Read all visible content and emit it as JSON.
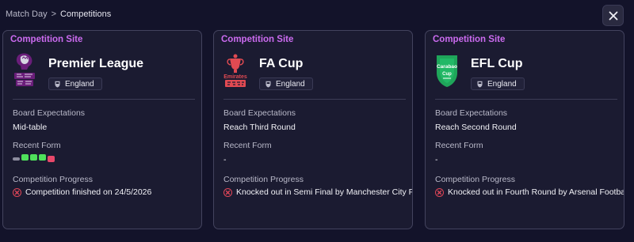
{
  "breadcrumb": {
    "parent": "Match Day",
    "separator": ">",
    "current": "Competitions"
  },
  "colors": {
    "accent": "#cc6bf0",
    "win": "#4fe05b",
    "draw": "#8c8c9e",
    "loss": "#e8486a",
    "eliminated": "#e04658"
  },
  "labels": {
    "board": "Board Expectations",
    "form": "Recent Form",
    "progress": "Competition Progress"
  },
  "cards": [
    {
      "heading": "Competition Site",
      "name": "Premier League",
      "logo": "premier-league-lion-logo",
      "nation": "England",
      "board_expectation": "Mid-table",
      "recent_form": [
        "D",
        "W",
        "W",
        "W",
        "L"
      ],
      "form_text": "",
      "progress_icon": "x-circle-icon",
      "progress": "Competition finished on 24/5/2026"
    },
    {
      "heading": "Competition Site",
      "name": "FA Cup",
      "logo": "fa-cup-trophy-logo",
      "nation": "England",
      "board_expectation": "Reach Third Round",
      "recent_form": [],
      "form_text": "-",
      "progress_icon": "x-circle-icon",
      "progress": "Knocked out in Semi Final by Manchester City Football Club"
    },
    {
      "heading": "Competition Site",
      "name": "EFL Cup",
      "logo": "carabao-cup-logo",
      "nation": "England",
      "board_expectation": "Reach Second Round",
      "recent_form": [],
      "form_text": "-",
      "progress_icon": "x-circle-icon",
      "progress": "Knocked out in Fourth Round by Arsenal Football Club"
    }
  ]
}
